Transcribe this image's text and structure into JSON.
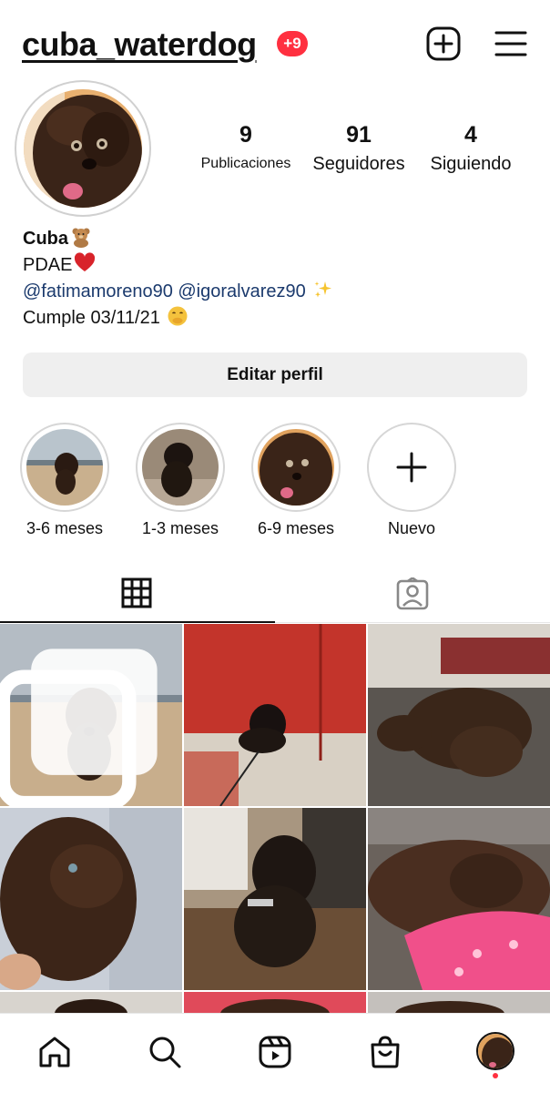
{
  "header": {
    "username": "cuba_waterdog",
    "notification_badge": "+9",
    "icons": [
      "new-post-icon",
      "menu-icon"
    ]
  },
  "profile": {
    "stats": {
      "posts": {
        "value": "9",
        "label": "Publicaciones"
      },
      "followers": {
        "value": "91",
        "label": "Seguidores"
      },
      "following": {
        "value": "4",
        "label": "Siguiendo"
      }
    },
    "bio": {
      "name": "Cuba",
      "line1": "PDAE",
      "mentions": "@fatimamoreno90 @igoralvarez90",
      "birthday": "Cumple 03/11/21"
    },
    "edit_button": "Editar perfil"
  },
  "highlights": [
    {
      "label": "3-6 meses"
    },
    {
      "label": "1-3 meses"
    },
    {
      "label": "6-9 meses"
    },
    {
      "label": "Nuevo"
    }
  ],
  "tabs": [
    {
      "name": "grid",
      "icon": "grid-icon",
      "active": true
    },
    {
      "name": "tagged",
      "icon": "tagged-user-icon",
      "active": false
    }
  ],
  "bottom_nav": {
    "items": [
      "home-icon",
      "search-icon",
      "reels-icon",
      "shop-icon",
      "profile-avatar"
    ],
    "notification_dot_color": "#ff3040"
  },
  "colors": {
    "badge": "#ff3040",
    "mention_link": "#1b3a6d",
    "button_bg": "#efefef"
  }
}
